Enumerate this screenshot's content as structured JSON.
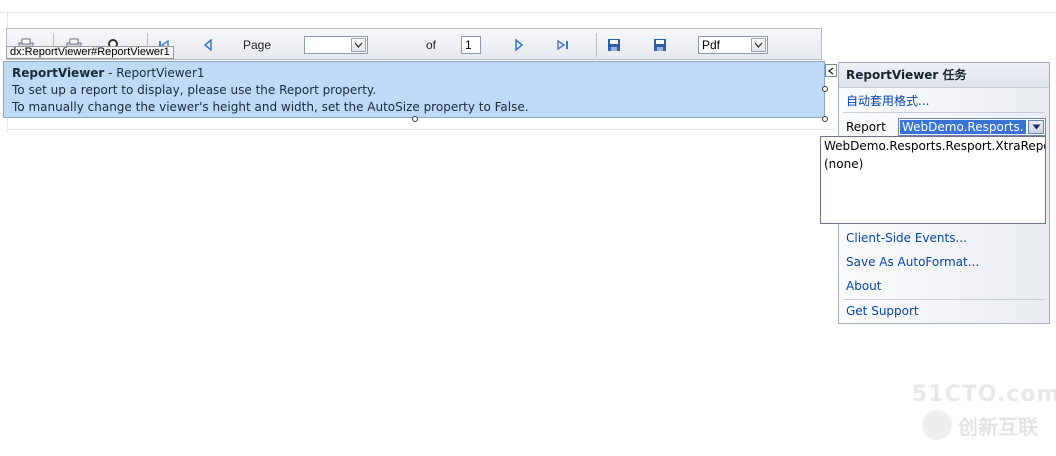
{
  "control_tag": "dx:ReportViewer#ReportViewer1",
  "toolbar": {
    "page_label": "Page",
    "page_value": "",
    "of_label": "of",
    "page_count": "1",
    "format_value": "Pdf",
    "icons": [
      "print-icon",
      "print-page-icon",
      "search-icon",
      "first-page-icon",
      "previous-page-icon",
      "next-page-icon",
      "last-page-icon",
      "save-icon",
      "save-to-window-icon"
    ]
  },
  "viewer": {
    "title": "ReportViewer",
    "title_suffix": " - ReportViewer1",
    "line1": "To set up a report to display, please use the Report property.",
    "line2": "To manually change the viewer's height and width, set the AutoSize property to False."
  },
  "tasks_panel": {
    "title": "ReportViewer 任务",
    "auto_format_link": "自动套用格式...",
    "report_label": "Report",
    "report_value": "WebDemo.Resports.",
    "dropdown_options": [
      "WebDemo.Resports.Resport.XtraRepo",
      "(none)"
    ],
    "links": [
      "Client-Side Events...",
      "Save As AutoFormat...",
      "About",
      "Get Support"
    ]
  },
  "watermark": {
    "top": "51CTO.com",
    "bottom": "创新互联"
  }
}
